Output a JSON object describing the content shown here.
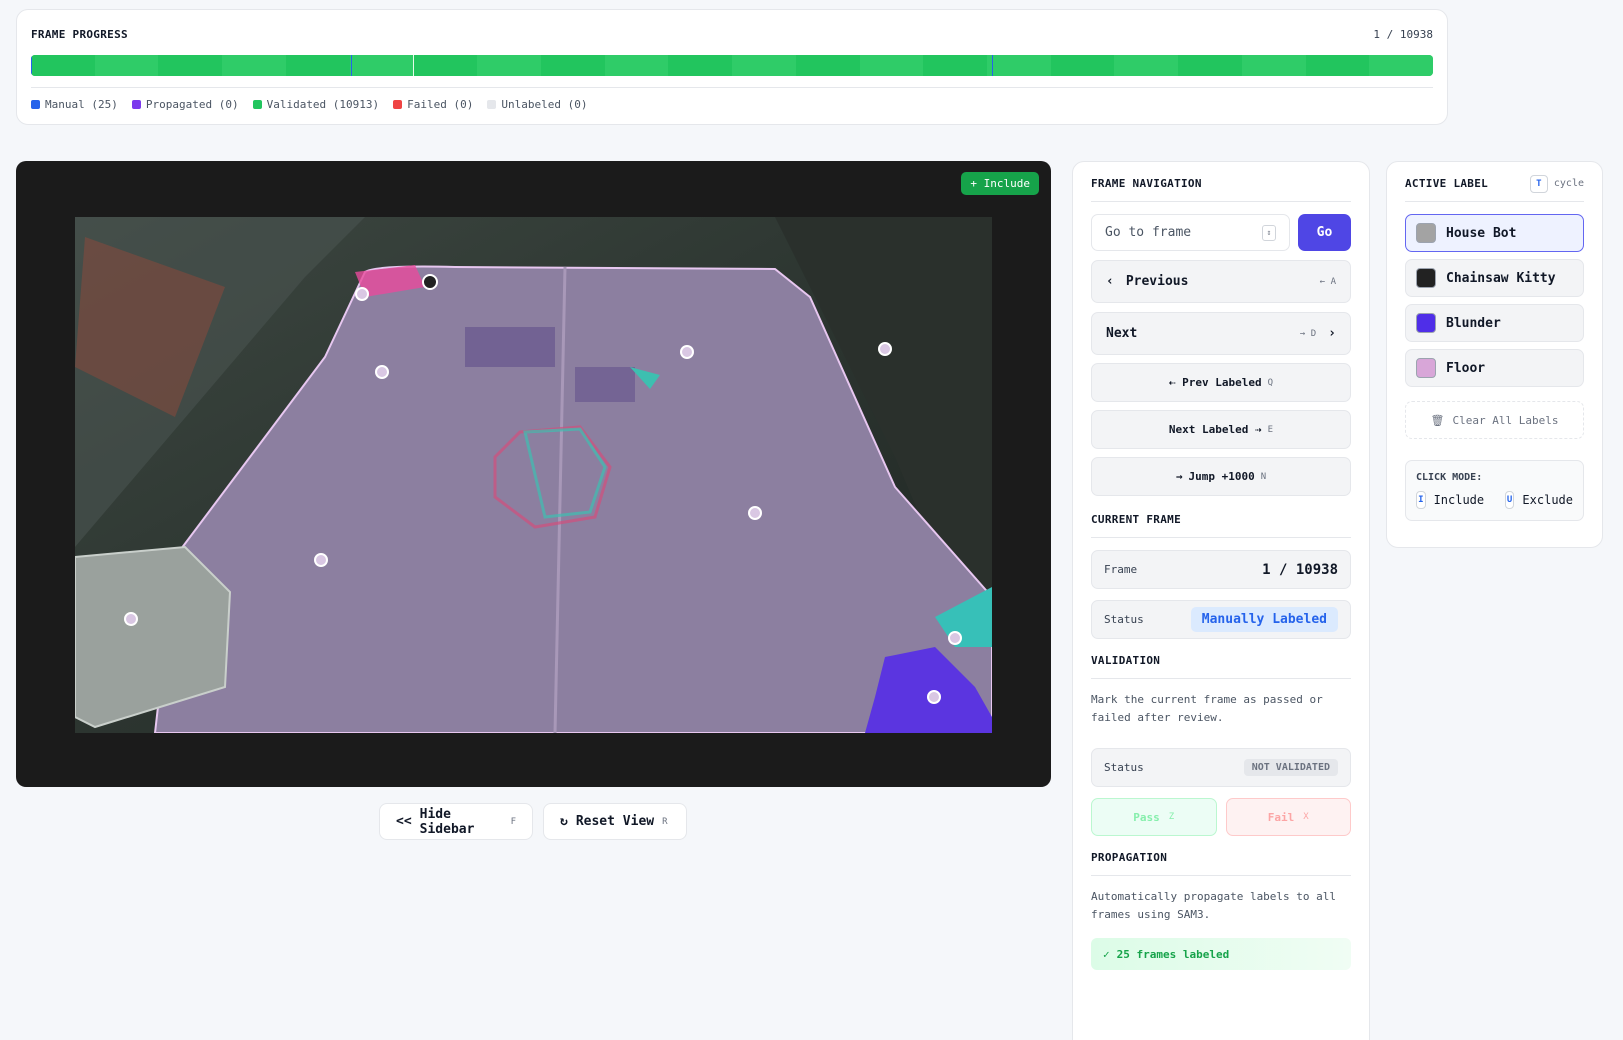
{
  "progress": {
    "title": "FRAME PROGRESS",
    "counter": "1 / 10938",
    "legend": [
      {
        "label": "Manual (25)",
        "color": "#2563eb"
      },
      {
        "label": "Propagated (0)",
        "color": "#7c3aed"
      },
      {
        "label": "Validated (10913)",
        "color": "#22c55e"
      },
      {
        "label": "Failed (0)",
        "color": "#ef4444"
      },
      {
        "label": "Unlabeled (0)",
        "color": "#e5e7eb"
      }
    ]
  },
  "viewer": {
    "include_badge": "+ Include"
  },
  "under": {
    "hide_sidebar": "Hide Sidebar",
    "hide_sidebar_key": "F",
    "reset_view": "Reset View",
    "reset_view_key": "R"
  },
  "navigation": {
    "title": "FRAME NAVIGATION",
    "goto_placeholder": "Go to frame",
    "go": "Go",
    "previous": "Previous",
    "previous_key": "← A",
    "next": "Next",
    "next_key": "→ D",
    "prev_labeled": "⇠ Prev Labeled",
    "prev_labeled_key": "Q",
    "next_labeled": "Next Labeled ⇢",
    "next_labeled_key": "E",
    "jump": "Jump +1000",
    "jump_key": "N"
  },
  "current_frame": {
    "title": "CURRENT FRAME",
    "frame_label": "Frame",
    "frame_value": "1 / 10938",
    "status_label": "Status",
    "status_value": "Manually Labeled"
  },
  "validation": {
    "title": "VALIDATION",
    "description": "Mark the current frame as passed or failed after review.",
    "status_label": "Status",
    "status_value": "NOT VALIDATED",
    "pass": "Pass",
    "pass_key": "Z",
    "fail": "Fail",
    "fail_key": "X"
  },
  "propagation": {
    "title": "PROPAGATION",
    "description": "Automatically propagate labels to all frames using SAM3.",
    "frames_labeled": "25 frames labeled"
  },
  "active_label": {
    "title": "ACTIVE LABEL",
    "cycle_key": "T",
    "cycle_text": "cycle",
    "labels": [
      {
        "name": "House Bot",
        "color": "#a3a3a3"
      },
      {
        "name": "Chainsaw Kitty",
        "color": "#222222"
      },
      {
        "name": "Blunder",
        "color": "#4f2ee8"
      },
      {
        "name": "Floor",
        "color": "#d8a6d8"
      }
    ],
    "clear_all": "Clear All Labels",
    "click_mode_title": "CLICK MODE:",
    "include_key": "I",
    "include": "Include",
    "exclude_key": "U",
    "exclude": "Exclude"
  }
}
